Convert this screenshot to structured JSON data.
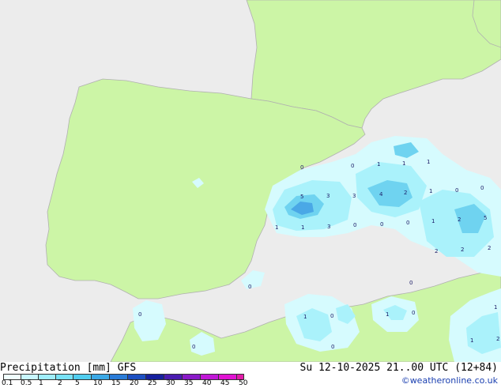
{
  "header": {
    "title": "Precipitation [mm]  GFS",
    "timestamp": "Su 12-10-2025 21..00 UTC (12+84)",
    "credit": "©weatheronline.co.uk"
  },
  "legend": {
    "ticks": [
      "0.1",
      "0.5",
      "1",
      "2",
      "5",
      "10",
      "15",
      "20",
      "25",
      "30",
      "35",
      "40",
      "45",
      "50"
    ],
    "colors": [
      "#f0ffff",
      "#c8f7ff",
      "#a0eefc",
      "#78e2f7",
      "#50cdef",
      "#3aa8e6",
      "#2a7cd8",
      "#1c4fc2",
      "#16209e",
      "#4a1cb0",
      "#8a1ac8",
      "#c018d6",
      "#e014d2",
      "#e21ca8"
    ]
  },
  "map": {
    "colors": {
      "sea": "#ececec",
      "land": "#ccf5a6",
      "border": "#b0b0b0",
      "precip_light": "#d6fbfe",
      "precip_mid": "#aaf2fb",
      "precip_heavy": "#6fd3f0",
      "precip_core": "#4aa8e6"
    },
    "precip_labels": [
      {
        "text": "0"
      },
      {
        "text": "0"
      },
      {
        "text": "1"
      },
      {
        "text": "1"
      },
      {
        "text": "1"
      },
      {
        "text": "5"
      },
      {
        "text": "3"
      },
      {
        "text": "3"
      },
      {
        "text": "4"
      },
      {
        "text": "2"
      },
      {
        "text": "1"
      },
      {
        "text": "0"
      },
      {
        "text": "0"
      },
      {
        "text": "1"
      },
      {
        "text": "1"
      },
      {
        "text": "3"
      },
      {
        "text": "0"
      },
      {
        "text": "0"
      },
      {
        "text": "0"
      },
      {
        "text": "1"
      },
      {
        "text": "2"
      },
      {
        "text": "5"
      },
      {
        "text": "2"
      },
      {
        "text": "2"
      },
      {
        "text": "2"
      },
      {
        "text": "0"
      },
      {
        "text": "0"
      },
      {
        "text": "0"
      },
      {
        "text": "1"
      },
      {
        "text": "0"
      },
      {
        "text": "1"
      },
      {
        "text": "0"
      },
      {
        "text": "0"
      },
      {
        "text": "0"
      },
      {
        "text": "1"
      },
      {
        "text": "1"
      },
      {
        "text": "2"
      }
    ]
  }
}
